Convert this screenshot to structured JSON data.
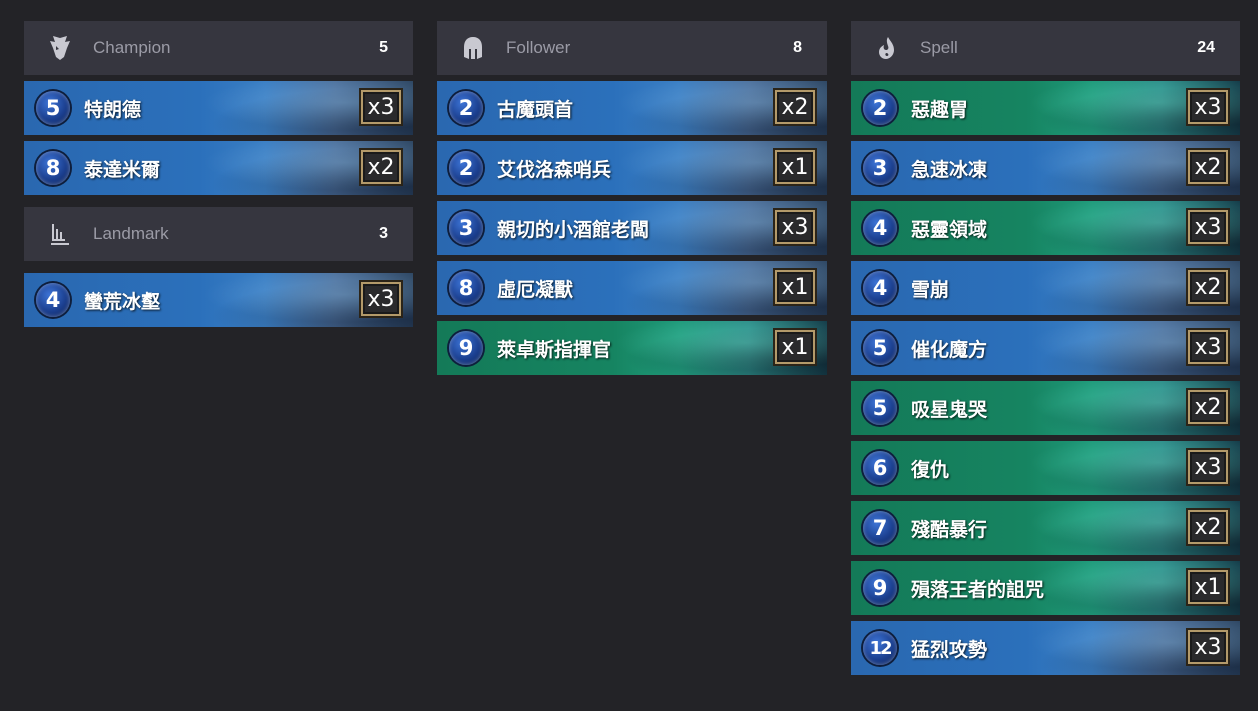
{
  "groups": {
    "champion": {
      "label": "Champion",
      "count": "5",
      "icon": "champion-helmet-icon",
      "cards": [
        {
          "cost": "5",
          "name": "特朗德",
          "qty": "x3",
          "region": "blue"
        },
        {
          "cost": "8",
          "name": "泰達米爾",
          "qty": "x2",
          "region": "blue"
        }
      ]
    },
    "landmark": {
      "label": "Landmark",
      "count": "3",
      "icon": "landmark-icon",
      "cards": [
        {
          "cost": "4",
          "name": "蠻荒冰壑",
          "qty": "x3",
          "region": "blue"
        }
      ]
    },
    "follower": {
      "label": "Follower",
      "count": "8",
      "icon": "follower-helmet-icon",
      "cards": [
        {
          "cost": "2",
          "name": "古魔頭首",
          "qty": "x2",
          "region": "blue"
        },
        {
          "cost": "2",
          "name": "艾伐洛森哨兵",
          "qty": "x1",
          "region": "blue"
        },
        {
          "cost": "3",
          "name": "親切的小酒館老闆",
          "qty": "x3",
          "region": "blue"
        },
        {
          "cost": "8",
          "name": "虛厄凝獸",
          "qty": "x1",
          "region": "blue"
        },
        {
          "cost": "9",
          "name": "萊卓斯指揮官",
          "qty": "x1",
          "region": "teal"
        }
      ]
    },
    "spell": {
      "label": "Spell",
      "count": "24",
      "icon": "spell-flame-icon",
      "cards": [
        {
          "cost": "2",
          "name": "惡趣胃",
          "qty": "x3",
          "region": "teal"
        },
        {
          "cost": "3",
          "name": "急速冰凍",
          "qty": "x2",
          "region": "blue"
        },
        {
          "cost": "4",
          "name": "惡靈領域",
          "qty": "x3",
          "region": "teal"
        },
        {
          "cost": "4",
          "name": "雪崩",
          "qty": "x2",
          "region": "blue"
        },
        {
          "cost": "5",
          "name": "催化魔方",
          "qty": "x3",
          "region": "blue"
        },
        {
          "cost": "5",
          "name": "吸星鬼哭",
          "qty": "x2",
          "region": "teal"
        },
        {
          "cost": "6",
          "name": "復仇",
          "qty": "x3",
          "region": "teal"
        },
        {
          "cost": "7",
          "name": "殘酷暴行",
          "qty": "x2",
          "region": "teal"
        },
        {
          "cost": "9",
          "name": "殞落王者的詛咒",
          "qty": "x1",
          "region": "teal"
        },
        {
          "cost": "12",
          "name": "猛烈攻勢",
          "qty": "x3",
          "region": "blue"
        }
      ]
    }
  },
  "colors": {
    "background": "#232327",
    "header_bg": "#36363f",
    "region_blue": "#2b70bb",
    "region_teal": "#168461",
    "qty_border": "#b39a6a"
  }
}
